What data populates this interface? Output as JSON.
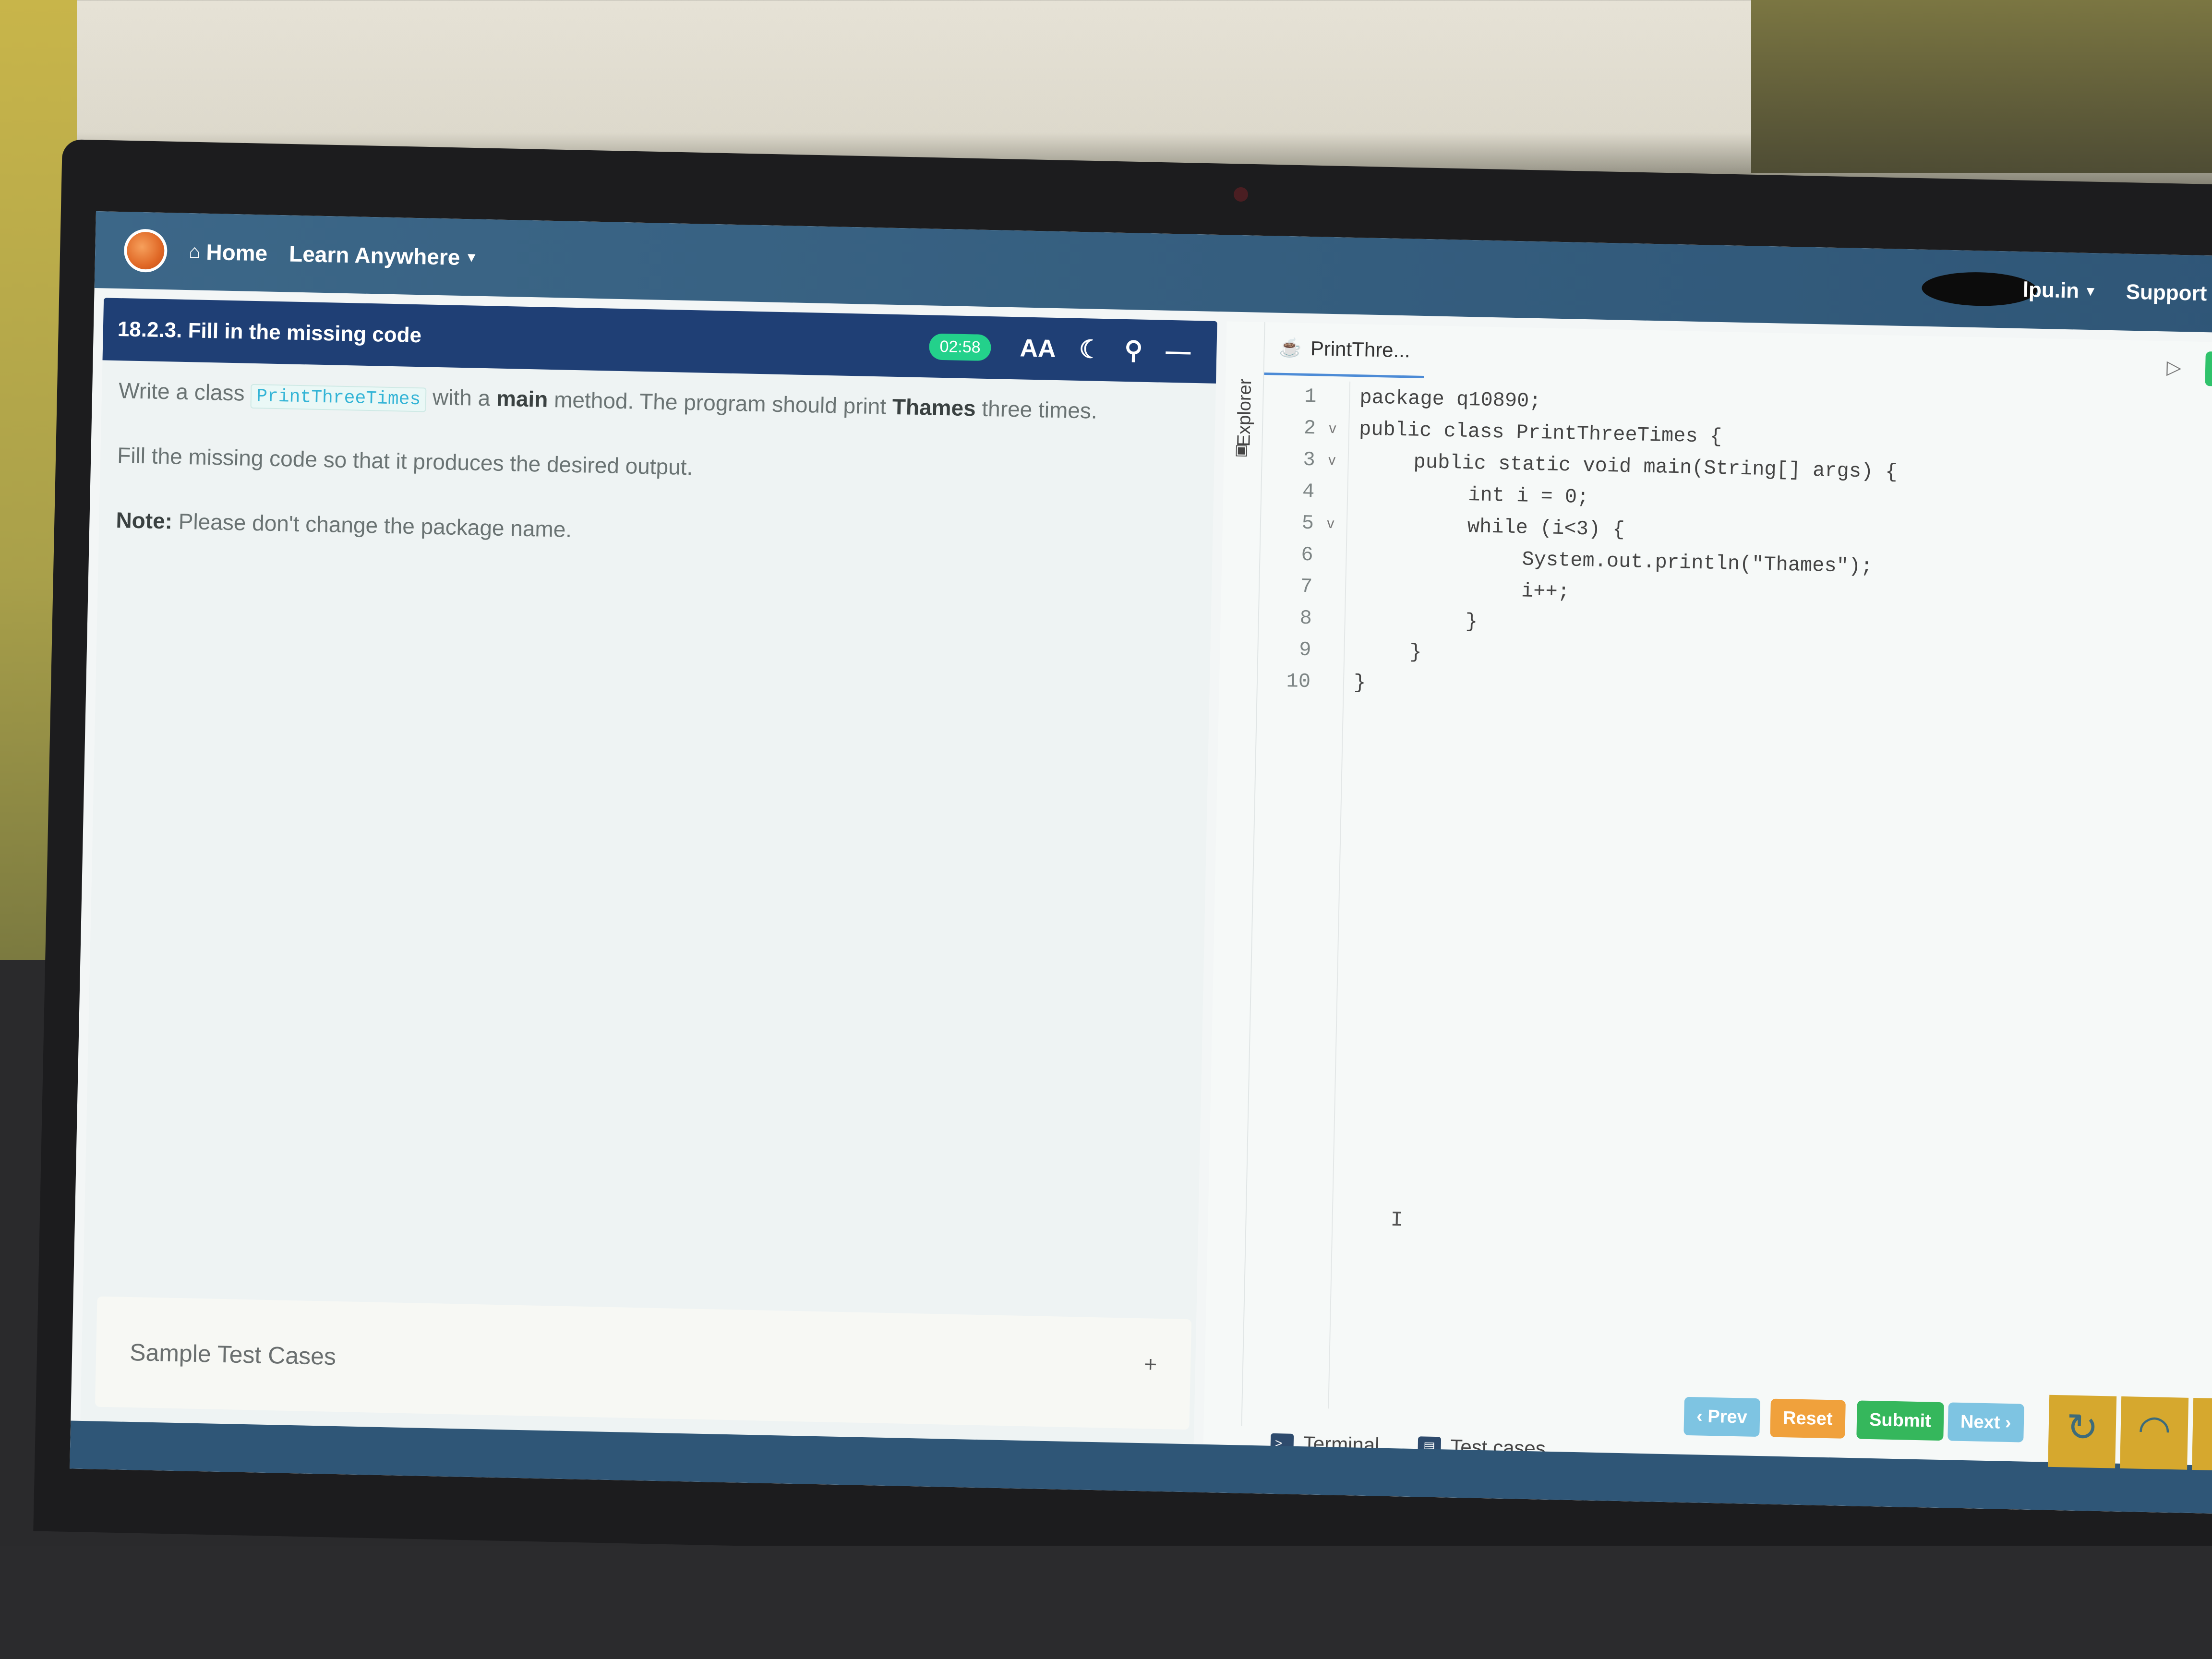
{
  "navbar": {
    "home_label": "Home",
    "learn_label": "Learn Anywhere",
    "domain_label": "lpu.in",
    "support_label": "Support"
  },
  "question": {
    "title": "18.2.3. Fill in the missing code",
    "timer": "02:58",
    "desc_part1": "Write a class",
    "class_name": "PrintThreeTimes",
    "desc_part2": "with a",
    "main_word": "main",
    "desc_part3": "method. The program should print",
    "thames_word": "Thames",
    "desc_part4": "three times.",
    "fill_text": "Fill the missing code so that it produces the desired output.",
    "note_label": "Note:",
    "note_text": "Please don't change the package name."
  },
  "sample": {
    "label": "Sample Test Cases",
    "toggle": "+"
  },
  "editor": {
    "explorer_label": "Explorer",
    "file_tab": "PrintThre...",
    "lines": [
      {
        "n": "1",
        "fold": "",
        "code": "package q10890;"
      },
      {
        "n": "2",
        "fold": "v",
        "code": "public class PrintThreeTimes {"
      },
      {
        "n": "3",
        "fold": "v",
        "code": "public static void main(String[] args) {"
      },
      {
        "n": "4",
        "fold": "",
        "code": "int i = 0;"
      },
      {
        "n": "5",
        "fold": "v",
        "code": "while (i<3) {"
      },
      {
        "n": "6",
        "fold": "",
        "code": "System.out.println(\"Thames\");"
      },
      {
        "n": "7",
        "fold": "",
        "code": "i++;"
      },
      {
        "n": "8",
        "fold": "",
        "code": "}"
      },
      {
        "n": "9",
        "fold": "",
        "code": "}"
      },
      {
        "n": "10",
        "fold": "",
        "code": "}"
      }
    ],
    "terminal_label": "Terminal",
    "testcases_label": "Test cases"
  },
  "actions": {
    "prev_label": "‹ Prev",
    "reset_label": "Reset",
    "submit_label": "Submit",
    "next_label": "Next ›"
  },
  "icons": {
    "home": "home-icon",
    "font_size": "font-size-icon",
    "dark_mode": "moon-icon",
    "link": "link-icon",
    "minimize": "minus-icon",
    "run": "run-icon"
  },
  "colors": {
    "navbar": "#2f5677",
    "title_bar": "#1f3f75",
    "timer": "#23d18b",
    "prev": "#7ec4e2",
    "reset": "#f0a13c",
    "submit": "#35b75c"
  }
}
